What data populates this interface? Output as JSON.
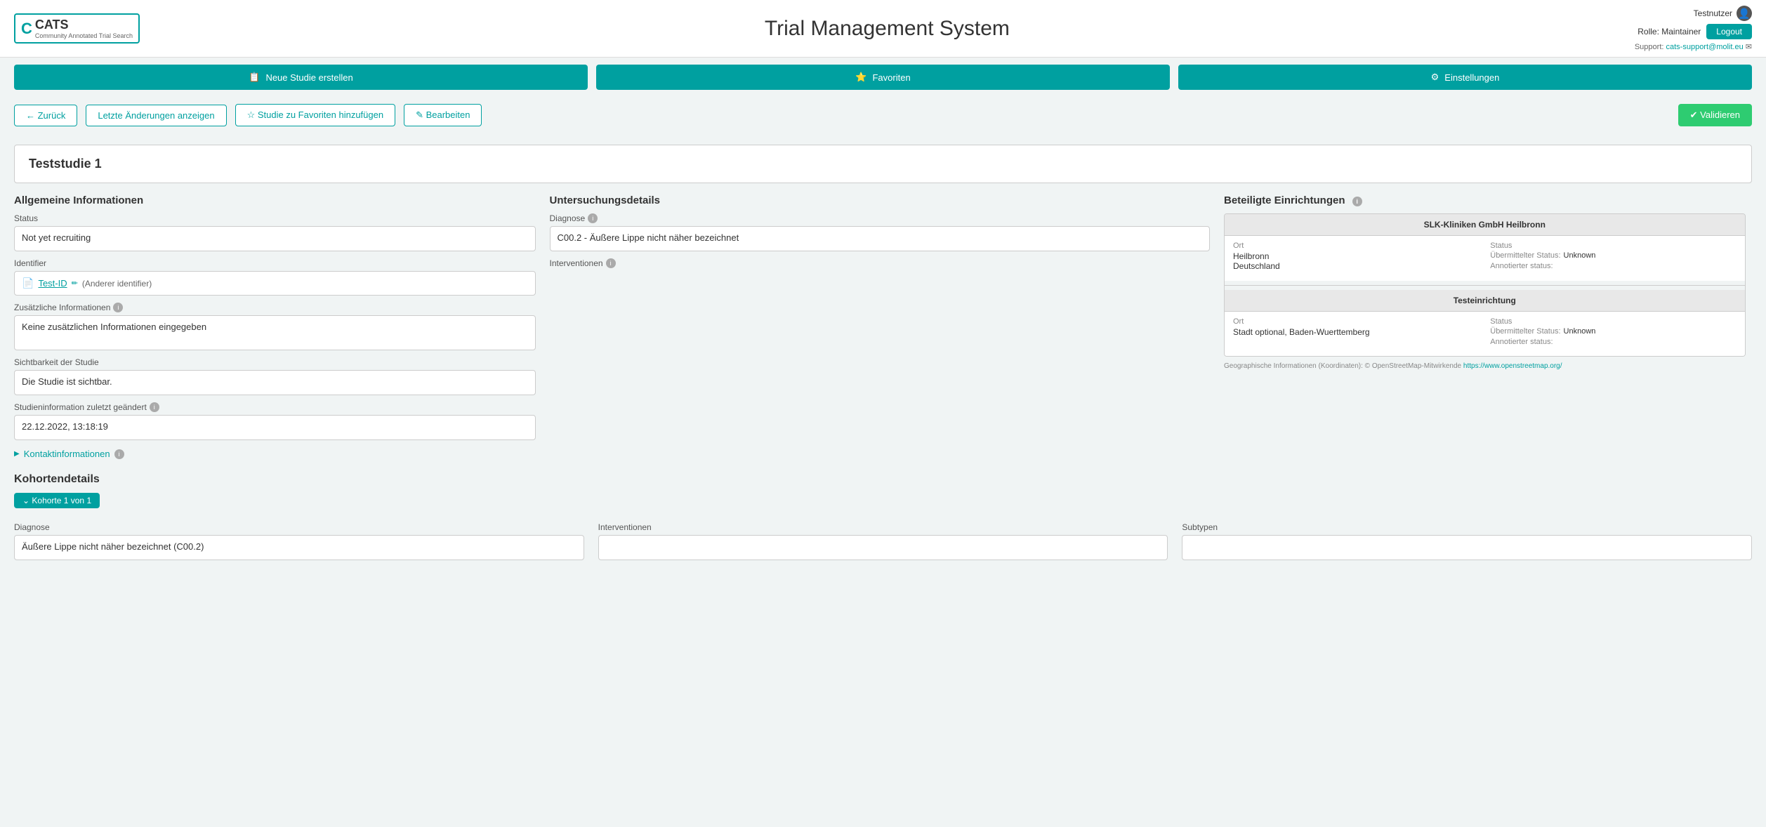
{
  "header": {
    "logo_text": "CATS",
    "logo_subtitle": "Community Annotated Trial Search",
    "app_title": "Trial Management System",
    "user_name": "Testnutzer",
    "role_label": "Rolle: Maintainer",
    "logout_label": "Logout",
    "support_label": "Support:",
    "support_email": "cats-support@molit.eu"
  },
  "nav": {
    "neue_studie": "Neue Studie erstellen",
    "favoriten": "Favoriten",
    "einstellungen": "Einstellungen"
  },
  "actions": {
    "zurueck": "← Zurück",
    "letzte_aenderungen": "Letzte Änderungen anzeigen",
    "favoriten_hinzufuegen": "☆ Studie zu Favoriten hinzufügen",
    "bearbeiten": "✎ Bearbeiten",
    "validieren": "✔ Validieren"
  },
  "study": {
    "title": "Teststudie 1"
  },
  "allgemeine": {
    "section_title": "Allgemeine Informationen",
    "status_label": "Status",
    "status_value": "Not yet recruiting",
    "identifier_label": "Identifier",
    "identifier_id": "Test-ID",
    "identifier_other": "(Anderer identifier)",
    "zusaetzliche_label": "Zusätzliche Informationen",
    "zusaetzliche_value": "Keine zusätzlichen Informationen eingegeben",
    "sichtbarkeit_label": "Sichtbarkeit der Studie",
    "sichtbarkeit_value": "Die Studie ist sichtbar.",
    "letztes_update_label": "Studieninformation zuletzt geändert",
    "letztes_update_value": "22.12.2022, 13:18:19",
    "kontakt_label": "Kontaktinformationen"
  },
  "untersuchung": {
    "section_title": "Untersuchungsdetails",
    "diagnose_label": "Diagnose",
    "diagnose_value": "C00.2 - Äußere Lippe nicht näher bezeichnet",
    "interventionen_label": "Interventionen"
  },
  "einrichtungen": {
    "section_title": "Beteiligte Einrichtungen",
    "facility1": {
      "name": "SLK-Kliniken GmbH Heilbronn",
      "ort_label": "Ort",
      "ort_value1": "Heilbronn",
      "ort_value2": "Deutschland",
      "status_label": "Status",
      "uebermittelter_label": "Übermittelter Status:",
      "uebermittelter_value": "Unknown",
      "annotierter_label": "Annotierter status:"
    },
    "facility2": {
      "name": "Testeinrichtung",
      "ort_label": "Ort",
      "ort_value1": "Stadt optional, Baden-Wuerttemberg",
      "status_label": "Status",
      "uebermittelter_label": "Übermittelter Status:",
      "uebermittelter_value": "Unknown",
      "annotierter_label": "Annotierter status:"
    },
    "geo_text": "Geographische Informationen (Koordinaten): © OpenStreetMap-Mitwirkende",
    "geo_link": "https://www.openstreetmap.org/"
  },
  "kohorten": {
    "section_title": "Kohortendetails",
    "badge_label": "⌄ Kohorte 1 von 1",
    "diagnose_label": "Diagnose",
    "diagnose_value": "Äußere Lippe nicht näher bezeichnet (C00.2)",
    "interventionen_label": "Interventionen",
    "subtypen_label": "Subtypen"
  }
}
